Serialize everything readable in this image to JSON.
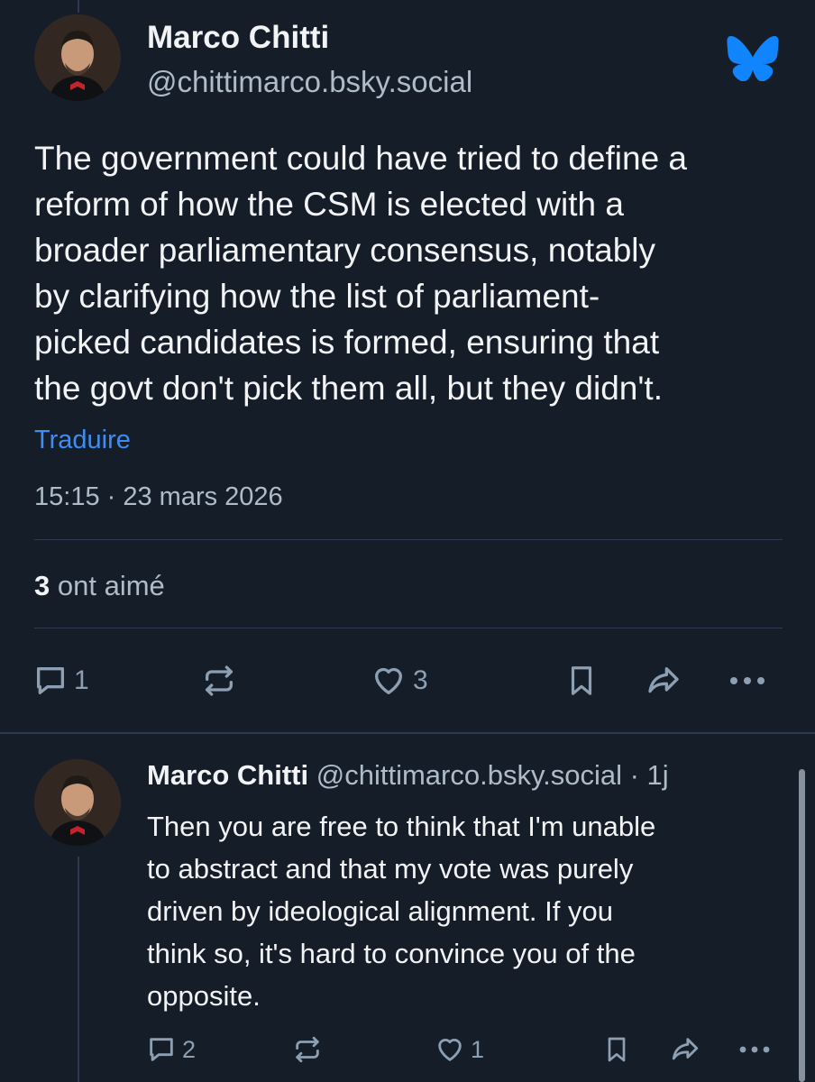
{
  "main_post": {
    "author_name": "Marco Chitti",
    "author_handle": "@chittimarco.bsky.social",
    "text_lines": [
      "The government could have tried to define a",
      "reform of how the CSM is elected with a",
      "broader parliamentary consensus, notably",
      "by clarifying how the list of parliament-",
      "picked candidates is formed, ensuring that",
      "the govt don't pick them all, but they didn't."
    ],
    "translate_label": "Traduire",
    "timestamp": "15:15 · 23 mars 2026",
    "likes_count": "3",
    "likes_label": "ont aimé",
    "actions": {
      "reply_count": "1",
      "like_count": "3"
    }
  },
  "reply_post": {
    "author_name": "Marco Chitti",
    "author_handle": "@chittimarco.bsky.social · 1j",
    "text_lines": [
      "Then you are free to think that I'm unable",
      "to abstract and that my vote was purely",
      "driven by ideological alignment. If you",
      "think so, it's hard to convince you of the",
      "opposite."
    ],
    "actions": {
      "reply_count": "2",
      "like_count": "1"
    }
  },
  "icons": {
    "logo": "bluesky-butterfly-icon",
    "reply": "speech-bubble-icon",
    "repost": "repost-arrows-icon",
    "like": "heart-icon",
    "bookmark": "bookmark-icon",
    "share": "share-arrow-icon",
    "more": "ellipsis-icon"
  },
  "colors": {
    "background": "#151d28",
    "text": "#f1f3f5",
    "muted": "#aebbc9",
    "link": "#3f8df0",
    "brand": "#1185fe",
    "divider": "#2c3a4d"
  }
}
